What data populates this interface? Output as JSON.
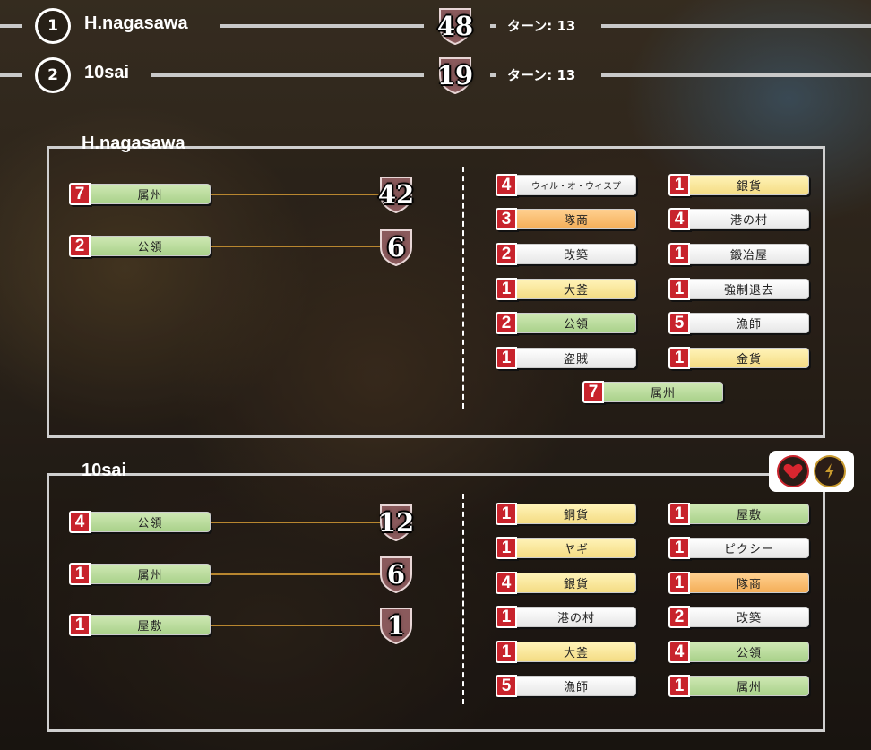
{
  "header": [
    {
      "rank": "1",
      "name": "H.nagasawa",
      "score": "48",
      "turn": "ターン: 13"
    },
    {
      "rank": "2",
      "name": "10sai",
      "score": "19",
      "turn": "ターン: 13"
    }
  ],
  "panels": [
    {
      "title": "H.nagasawa",
      "groups": [
        {
          "count": "7",
          "label": "属州",
          "color": "green",
          "score": "42"
        },
        {
          "count": "2",
          "label": "公領",
          "color": "green",
          "score": "6"
        }
      ],
      "cards_left": [
        {
          "count": "4",
          "label": "ウィル・オ・ウィスプ",
          "color": "white"
        },
        {
          "count": "3",
          "label": "隊商",
          "color": "orange"
        },
        {
          "count": "2",
          "label": "改築",
          "color": "white"
        },
        {
          "count": "1",
          "label": "大釜",
          "color": "yellow"
        },
        {
          "count": "2",
          "label": "公領",
          "color": "green"
        },
        {
          "count": "1",
          "label": "盗賊",
          "color": "white"
        }
      ],
      "cards_right": [
        {
          "count": "1",
          "label": "銀貨",
          "color": "yellow"
        },
        {
          "count": "4",
          "label": "港の村",
          "color": "white"
        },
        {
          "count": "1",
          "label": "鍛冶屋",
          "color": "white"
        },
        {
          "count": "1",
          "label": "強制退去",
          "color": "white"
        },
        {
          "count": "5",
          "label": "漁師",
          "color": "white"
        },
        {
          "count": "1",
          "label": "金貨",
          "color": "yellow"
        }
      ],
      "card_extra": {
        "count": "7",
        "label": "属州",
        "color": "green"
      }
    },
    {
      "title": "10sai",
      "groups": [
        {
          "count": "4",
          "label": "公領",
          "color": "green",
          "score": "12"
        },
        {
          "count": "1",
          "label": "属州",
          "color": "green",
          "score": "6"
        },
        {
          "count": "1",
          "label": "屋敷",
          "color": "green",
          "score": "1"
        }
      ],
      "cards_left": [
        {
          "count": "1",
          "label": "銅貨",
          "color": "yellow"
        },
        {
          "count": "1",
          "label": "ヤギ",
          "color": "yellow"
        },
        {
          "count": "4",
          "label": "銀貨",
          "color": "yellow"
        },
        {
          "count": "1",
          "label": "港の村",
          "color": "white"
        },
        {
          "count": "1",
          "label": "大釜",
          "color": "yellow"
        },
        {
          "count": "5",
          "label": "漁師",
          "color": "white"
        }
      ],
      "cards_right": [
        {
          "count": "1",
          "label": "屋敷",
          "color": "green"
        },
        {
          "count": "1",
          "label": "ピクシー",
          "color": "white"
        },
        {
          "count": "1",
          "label": "隊商",
          "color": "orange"
        },
        {
          "count": "2",
          "label": "改築",
          "color": "white"
        },
        {
          "count": "4",
          "label": "公領",
          "color": "green"
        },
        {
          "count": "1",
          "label": "属州",
          "color": "green"
        }
      ]
    }
  ],
  "buttons": {
    "like_icon": "heart-icon",
    "flash_icon": "lightning-icon"
  },
  "colors": {
    "accent_red": "#c8232c",
    "line_gold": "#b8862f",
    "border": "#cfcfcf"
  }
}
